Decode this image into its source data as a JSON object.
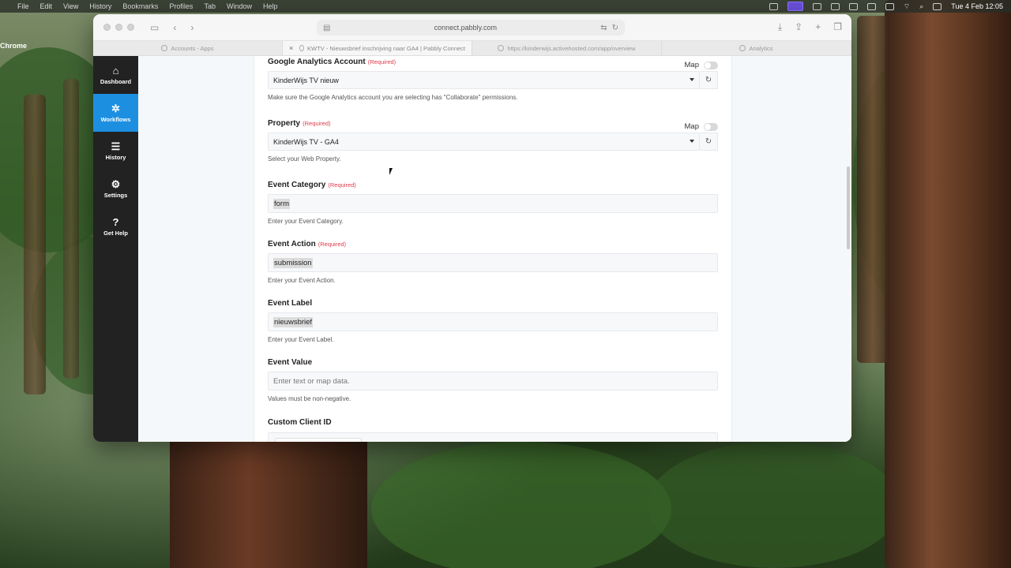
{
  "menubar": {
    "app": "Chrome",
    "items": [
      "File",
      "Edit",
      "View",
      "History",
      "Bookmarks",
      "Profiles",
      "Tab",
      "Window",
      "Help"
    ],
    "datetime": "Tue 4 Feb  12:05"
  },
  "browser": {
    "url": "connect.pabbly.com",
    "tabs": [
      {
        "label": "Accounts - Apps",
        "active": false
      },
      {
        "label": "KWTV - Nieuwsbrief inschrijving naar GA4 | Pabbly Connect",
        "active": true
      },
      {
        "label": "https://kinderwijs.activehosted.com/app/overview",
        "active": false
      },
      {
        "label": "Analytics",
        "active": false
      }
    ]
  },
  "sidebar": {
    "items": [
      {
        "label": "Dashboard",
        "icon": "home-icon",
        "glyph": "⌂"
      },
      {
        "label": "Workflows",
        "icon": "workflows-icon",
        "glyph": "✲"
      },
      {
        "label": "History",
        "icon": "list-icon",
        "glyph": "☰"
      },
      {
        "label": "Settings",
        "icon": "gear-icon",
        "glyph": "⚙"
      },
      {
        "label": "Get Help",
        "icon": "help-icon",
        "glyph": "?"
      }
    ]
  },
  "form": {
    "required_tag": "(Required)",
    "map_label": "Map",
    "ga_account": {
      "label": "Google Analytics Account",
      "value": "KinderWijs TV nieuw",
      "hint": "Make sure the Google Analytics account you are selecting has \"Collaborate\" permissions."
    },
    "property": {
      "label": "Property",
      "value": "KinderWijs TV - GA4",
      "hint": "Select your Web Property."
    },
    "event_category": {
      "label": "Event Category",
      "value": "form",
      "hint": "Enter your Event Category."
    },
    "event_action": {
      "label": "Event Action",
      "value": "submission",
      "hint": "Enter your Event Action."
    },
    "event_label": {
      "label": "Event Label",
      "value": "nieuwsbrief",
      "hint": "Enter your Event Label."
    },
    "event_value": {
      "label": "Event Value",
      "placeholder": "Enter text or map data.",
      "hint": "Values must be non-negative."
    },
    "custom_client_id": {
      "label": "Custom Client ID"
    }
  }
}
